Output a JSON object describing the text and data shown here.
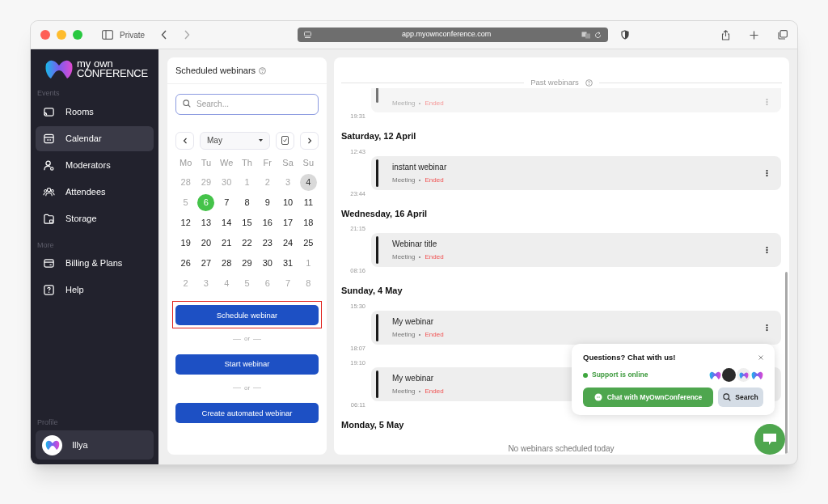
{
  "browser": {
    "mode": "Private",
    "url": "app.myownconference.com"
  },
  "logo": {
    "line1": "my own",
    "line2": "CONFERENCE"
  },
  "sidebar": {
    "sections": [
      {
        "title": "Events",
        "items": [
          {
            "label": "Rooms",
            "selected": false
          },
          {
            "label": "Calendar",
            "selected": true
          },
          {
            "label": "Moderators",
            "selected": false
          },
          {
            "label": "Attendees",
            "selected": false
          },
          {
            "label": "Storage",
            "selected": false
          }
        ]
      },
      {
        "title": "More",
        "items": [
          {
            "label": "Billing & Plans",
            "selected": false
          },
          {
            "label": "Help",
            "selected": false
          }
        ]
      }
    ],
    "profile": {
      "title": "Profile",
      "name": "Illya"
    }
  },
  "scheduler": {
    "title": "Scheduled webinars",
    "search_placeholder": "Search...",
    "month": "May",
    "weekdays": [
      "Mo",
      "Tu",
      "We",
      "Th",
      "Fr",
      "Sa",
      "Su"
    ],
    "weeks": [
      [
        {
          "d": "28",
          "outside": true,
          "selected": false,
          "marked": false
        },
        {
          "d": "29",
          "outside": true,
          "selected": false,
          "marked": false
        },
        {
          "d": "30",
          "outside": true,
          "selected": false,
          "marked": false
        },
        {
          "d": "1",
          "outside": true,
          "selected": false,
          "marked": false
        },
        {
          "d": "2",
          "outside": true,
          "selected": false,
          "marked": false
        },
        {
          "d": "3",
          "outside": true,
          "selected": false,
          "marked": false
        },
        {
          "d": "4",
          "outside": false,
          "selected": false,
          "marked": true
        }
      ],
      [
        {
          "d": "5",
          "outside": true,
          "selected": false,
          "marked": false
        },
        {
          "d": "6",
          "outside": false,
          "selected": true,
          "marked": false
        },
        {
          "d": "7",
          "outside": false,
          "selected": false,
          "marked": false
        },
        {
          "d": "8",
          "outside": false,
          "selected": false,
          "marked": false
        },
        {
          "d": "9",
          "outside": false,
          "selected": false,
          "marked": false
        },
        {
          "d": "10",
          "outside": false,
          "selected": false,
          "marked": false
        },
        {
          "d": "11",
          "outside": false,
          "selected": false,
          "marked": false
        }
      ],
      [
        {
          "d": "12",
          "outside": false,
          "selected": false,
          "marked": false
        },
        {
          "d": "13",
          "outside": false,
          "selected": false,
          "marked": false
        },
        {
          "d": "14",
          "outside": false,
          "selected": false,
          "marked": false
        },
        {
          "d": "15",
          "outside": false,
          "selected": false,
          "marked": false
        },
        {
          "d": "16",
          "outside": false,
          "selected": false,
          "marked": false
        },
        {
          "d": "17",
          "outside": false,
          "selected": false,
          "marked": false
        },
        {
          "d": "18",
          "outside": false,
          "selected": false,
          "marked": false
        }
      ],
      [
        {
          "d": "19",
          "outside": false,
          "selected": false,
          "marked": false
        },
        {
          "d": "20",
          "outside": false,
          "selected": false,
          "marked": false
        },
        {
          "d": "21",
          "outside": false,
          "selected": false,
          "marked": false
        },
        {
          "d": "22",
          "outside": false,
          "selected": false,
          "marked": false
        },
        {
          "d": "23",
          "outside": false,
          "selected": false,
          "marked": false
        },
        {
          "d": "24",
          "outside": false,
          "selected": false,
          "marked": false
        },
        {
          "d": "25",
          "outside": false,
          "selected": false,
          "marked": false
        }
      ],
      [
        {
          "d": "26",
          "outside": false,
          "selected": false,
          "marked": false
        },
        {
          "d": "27",
          "outside": false,
          "selected": false,
          "marked": false
        },
        {
          "d": "28",
          "outside": false,
          "selected": false,
          "marked": false
        },
        {
          "d": "29",
          "outside": false,
          "selected": false,
          "marked": false
        },
        {
          "d": "30",
          "outside": false,
          "selected": false,
          "marked": false
        },
        {
          "d": "31",
          "outside": false,
          "selected": false,
          "marked": false
        },
        {
          "d": "1",
          "outside": true,
          "selected": false,
          "marked": false
        }
      ],
      [
        {
          "d": "2",
          "outside": true,
          "selected": false,
          "marked": false
        },
        {
          "d": "3",
          "outside": true,
          "selected": false,
          "marked": false
        },
        {
          "d": "4",
          "outside": true,
          "selected": false,
          "marked": false
        },
        {
          "d": "5",
          "outside": true,
          "selected": false,
          "marked": false
        },
        {
          "d": "6",
          "outside": true,
          "selected": false,
          "marked": false
        },
        {
          "d": "7",
          "outside": true,
          "selected": false,
          "marked": false
        },
        {
          "d": "8",
          "outside": true,
          "selected": false,
          "marked": false
        }
      ]
    ],
    "actions": [
      {
        "label": "Schedule webinar",
        "highlighted": true
      },
      {
        "label": "Start webinar",
        "highlighted": false
      },
      {
        "label": "Create automated webinar",
        "highlighted": false
      }
    ],
    "separators": [
      "or",
      "or"
    ]
  },
  "timeline": {
    "title": "Past webinars",
    "partial_event": {
      "type": "Meeting",
      "status": "Ended",
      "end": "19:31"
    },
    "days": [
      {
        "date": "Saturday, 12 April",
        "events": [
          {
            "start": "12:43",
            "title": "instant webinar",
            "type": "Meeting",
            "status": "Ended",
            "end": "23:44"
          }
        ]
      },
      {
        "date": "Wednesday, 16 April",
        "events": [
          {
            "start": "21:15",
            "title": "Webinar title",
            "type": "Meeting",
            "status": "Ended",
            "end": "08:16"
          }
        ]
      },
      {
        "date": "Sunday, 4 May",
        "events": [
          {
            "start": "15:30",
            "title": "My webinar",
            "type": "Meeting",
            "status": "Ended",
            "end": "18:07"
          },
          {
            "start": "19:10",
            "title": "My webinar",
            "type": "Meeting",
            "status": "Ended",
            "end": "06:11"
          }
        ]
      },
      {
        "date": "Monday, 5 May",
        "empty_text": "No webinars scheduled today"
      }
    ]
  },
  "chat_widget": {
    "title": "Questions? Chat with us!",
    "status": "Support is online",
    "online": true,
    "chat_button": "Chat with MyOwnConference",
    "search_button": "Search"
  }
}
